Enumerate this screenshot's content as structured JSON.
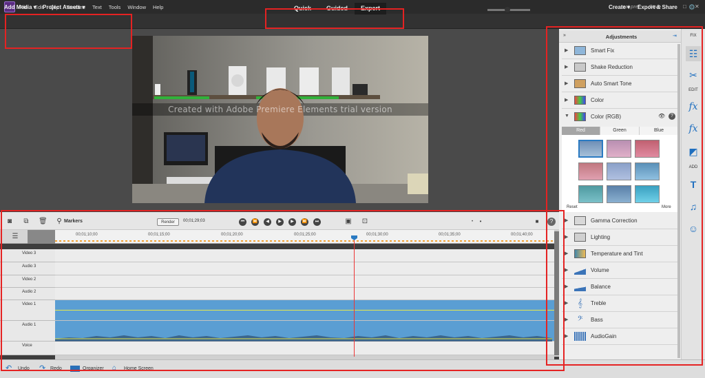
{
  "menubar": {
    "items": [
      "File",
      "Edit",
      "Clip",
      "Timeline",
      "Text",
      "Tools",
      "Window",
      "Help"
    ],
    "project_title": "test.prel",
    "save": "Save"
  },
  "toolbar": {
    "add_media": "Add Media ▾",
    "project_assets": "Project Assets ▾",
    "modes": [
      "Quick",
      "Guided",
      "Expert"
    ],
    "active_mode": "Expert",
    "create": "Create ▾",
    "export_share": "Export & Share"
  },
  "monitor": {
    "watermark": "Created with  Adobe Premiere Elements  trial version"
  },
  "timeline": {
    "markers": "Markers",
    "render": "Render",
    "timecode": "00;01;29;03",
    "ruler_ticks": [
      "00;01;10;00",
      "00;01;15;00",
      "00;01;20;00",
      "00;01;25;00",
      "00;01;30;00",
      "00;01;35;00",
      "00;01;40;00"
    ],
    "tracks": [
      "Video 3",
      "Audio 3",
      "Video 2",
      "Audio 2",
      "Video 1",
      "Audio 1",
      "Voice"
    ]
  },
  "bottombar": {
    "undo": "Undo",
    "redo": "Redo",
    "organizer": "Organizer",
    "home_screen": "Home Screen"
  },
  "adjustments": {
    "title": "Adjustments",
    "items_top": [
      "Smart Fix",
      "Shake Reduction",
      "Auto Smart Tone",
      "Color"
    ],
    "color_rgb": "Color (RGB)",
    "rgb_tabs": [
      "Red",
      "Green",
      "Blue"
    ],
    "reset": "Reset",
    "more": "More",
    "items_bottom": [
      "Gamma Correction",
      "Lighting",
      "Temperature and Tint",
      "Volume",
      "Balance",
      "Treble",
      "Bass",
      "AudioGain"
    ]
  },
  "right_tabs": {
    "fix": "FIX",
    "edit": "EDIT",
    "add": "ADD"
  },
  "colors": {
    "accent": "#2a7ac2",
    "highlight_box": "#e52222",
    "clip": "#5a9ed3"
  }
}
